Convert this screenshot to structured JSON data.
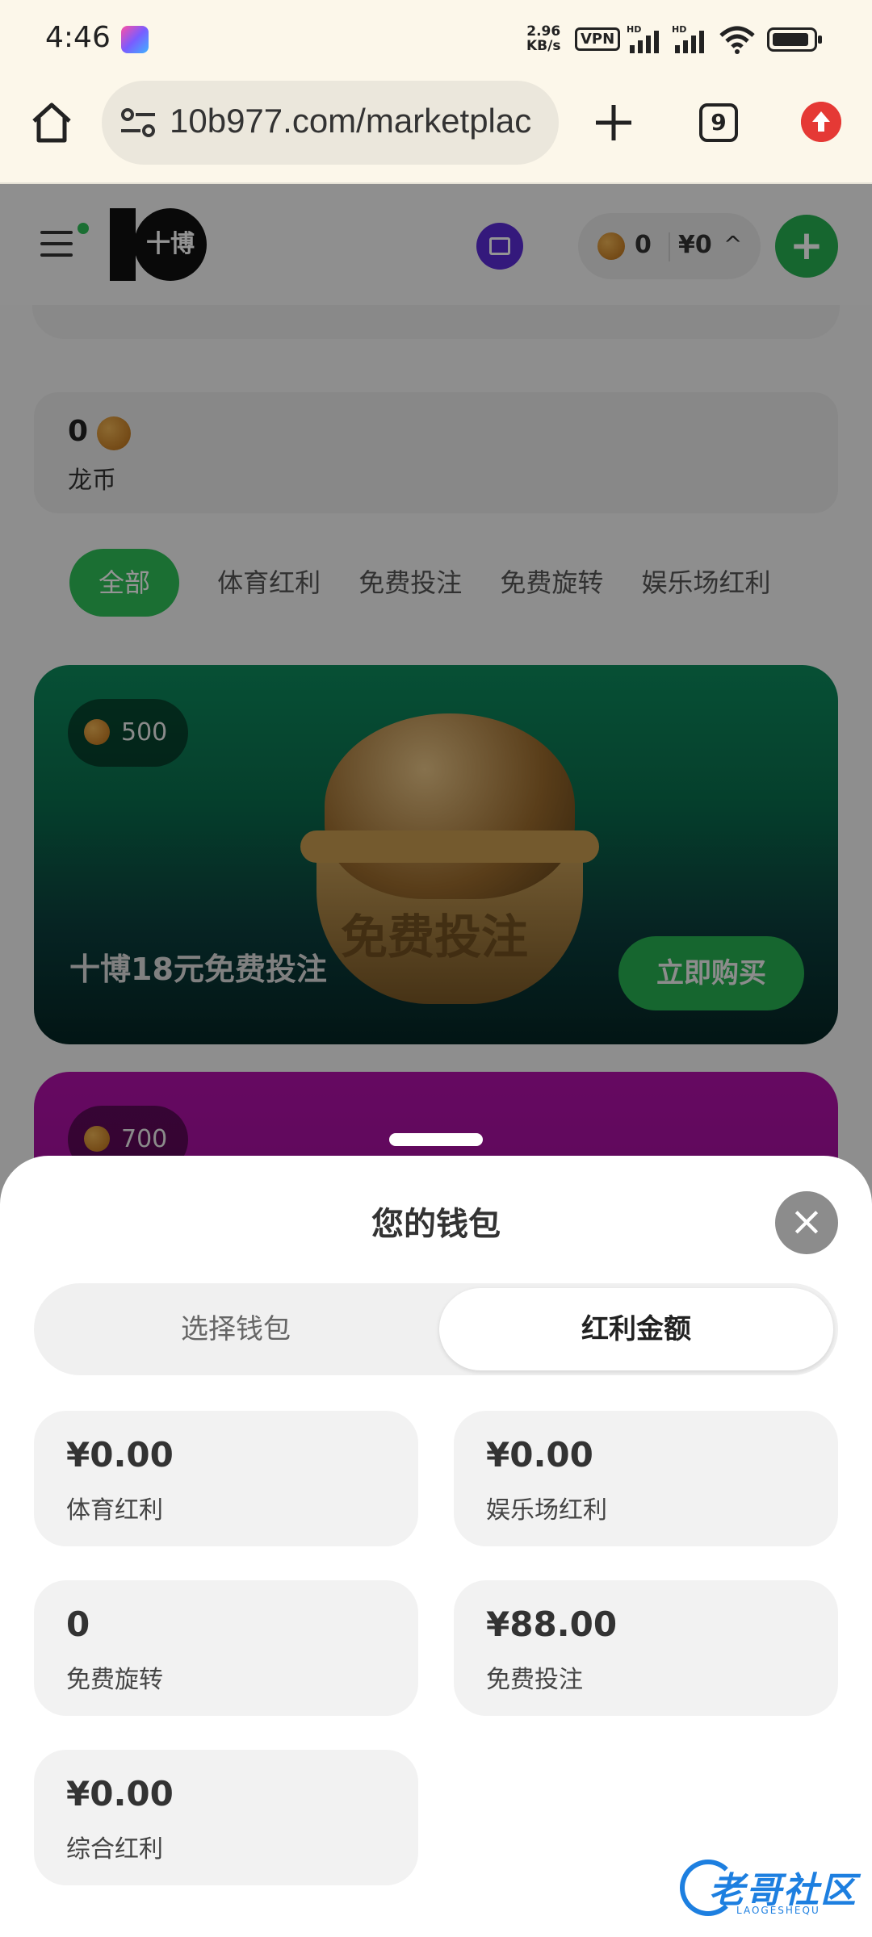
{
  "status_bar": {
    "time": "4:46",
    "net_speed_value": "2.96",
    "net_speed_unit": "KB/s",
    "vpn_label": "VPN",
    "hd_label": "HD"
  },
  "browser": {
    "url": "10b977.com/marketplac",
    "tab_count": "9"
  },
  "header": {
    "logo_text": "十博",
    "wallet_coins": "0",
    "wallet_money": "¥0"
  },
  "balance_card": {
    "value": "0",
    "label": "龙币"
  },
  "categories": [
    {
      "label": "全部",
      "active": true
    },
    {
      "label": "体育红利",
      "active": false
    },
    {
      "label": "免费投注",
      "active": false
    },
    {
      "label": "免费旋转",
      "active": false
    },
    {
      "label": "娱乐场红利",
      "active": false
    }
  ],
  "promos": [
    {
      "price": "500",
      "title": "十博18元免费投注",
      "artwork_text": "免费投注",
      "button": "立即购买"
    },
    {
      "price": "700"
    }
  ],
  "wallet_sheet": {
    "title": "您的钱包",
    "tabs": [
      {
        "label": "选择钱包",
        "active": false
      },
      {
        "label": "红利金额",
        "active": true
      }
    ],
    "bonuses": [
      {
        "amount": "¥0.00",
        "label": "体育红利"
      },
      {
        "amount": "¥0.00",
        "label": "娱乐场红利"
      },
      {
        "amount": "0",
        "label": "免费旋转"
      },
      {
        "amount": "¥88.00",
        "label": "免费投注"
      },
      {
        "amount": "¥0.00",
        "label": "综合红利"
      }
    ]
  },
  "watermark": {
    "text": "老哥社区",
    "sub": "LAOGESHEQU"
  },
  "colors": {
    "accent_green": "#2fbf58",
    "browser_bg": "#fcf7ea",
    "promo_green": "#0a6e4d",
    "promo_purple": "#b011a8"
  }
}
